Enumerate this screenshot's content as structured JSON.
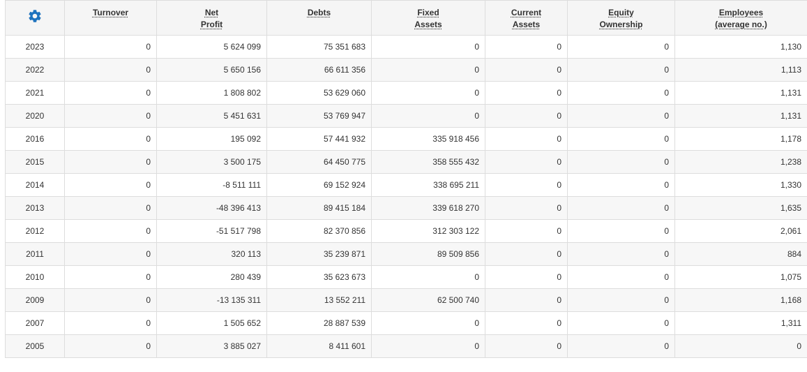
{
  "table": {
    "settings_icon": "gear-icon",
    "accent_color": "#1e73be",
    "headers": [
      {
        "line1": "Turnover",
        "line2": ""
      },
      {
        "line1": "Net",
        "line2": "Profit"
      },
      {
        "line1": "Debts",
        "line2": ""
      },
      {
        "line1": "Fixed",
        "line2": "Assets"
      },
      {
        "line1": "Current",
        "line2": "Assets"
      },
      {
        "line1": "Equity",
        "line2": "Ownership"
      },
      {
        "line1": "Employees",
        "line2": "(average no.)"
      }
    ],
    "rows": [
      [
        "2023",
        "0",
        "5 624 099",
        "75 351 683",
        "0",
        "0",
        "0",
        "1,130"
      ],
      [
        "2022",
        "0",
        "5 650 156",
        "66 611 356",
        "0",
        "0",
        "0",
        "1,113"
      ],
      [
        "2021",
        "0",
        "1 808 802",
        "53 629 060",
        "0",
        "0",
        "0",
        "1,131"
      ],
      [
        "2020",
        "0",
        "5 451 631",
        "53 769 947",
        "0",
        "0",
        "0",
        "1,131"
      ],
      [
        "2016",
        "0",
        "195 092",
        "57 441 932",
        "335 918 456",
        "0",
        "0",
        "1,178"
      ],
      [
        "2015",
        "0",
        "3 500 175",
        "64 450 775",
        "358 555 432",
        "0",
        "0",
        "1,238"
      ],
      [
        "2014",
        "0",
        "-8 511 111",
        "69 152 924",
        "338 695 211",
        "0",
        "0",
        "1,330"
      ],
      [
        "2013",
        "0",
        "-48 396 413",
        "89 415 184",
        "339 618 270",
        "0",
        "0",
        "1,635"
      ],
      [
        "2012",
        "0",
        "-51 517 798",
        "82 370 856",
        "312 303 122",
        "0",
        "0",
        "2,061"
      ],
      [
        "2011",
        "0",
        "320 113",
        "35 239 871",
        "89 509 856",
        "0",
        "0",
        "884"
      ],
      [
        "2010",
        "0",
        "280 439",
        "35 623 673",
        "0",
        "0",
        "0",
        "1,075"
      ],
      [
        "2009",
        "0",
        "-13 135 311",
        "13 552 211",
        "62 500 740",
        "0",
        "0",
        "1,168"
      ],
      [
        "2007",
        "0",
        "1 505 652",
        "28 887 539",
        "0",
        "0",
        "0",
        "1,311"
      ],
      [
        "2005",
        "0",
        "3 885 027",
        "8 411 601",
        "0",
        "0",
        "0",
        "0"
      ]
    ]
  }
}
